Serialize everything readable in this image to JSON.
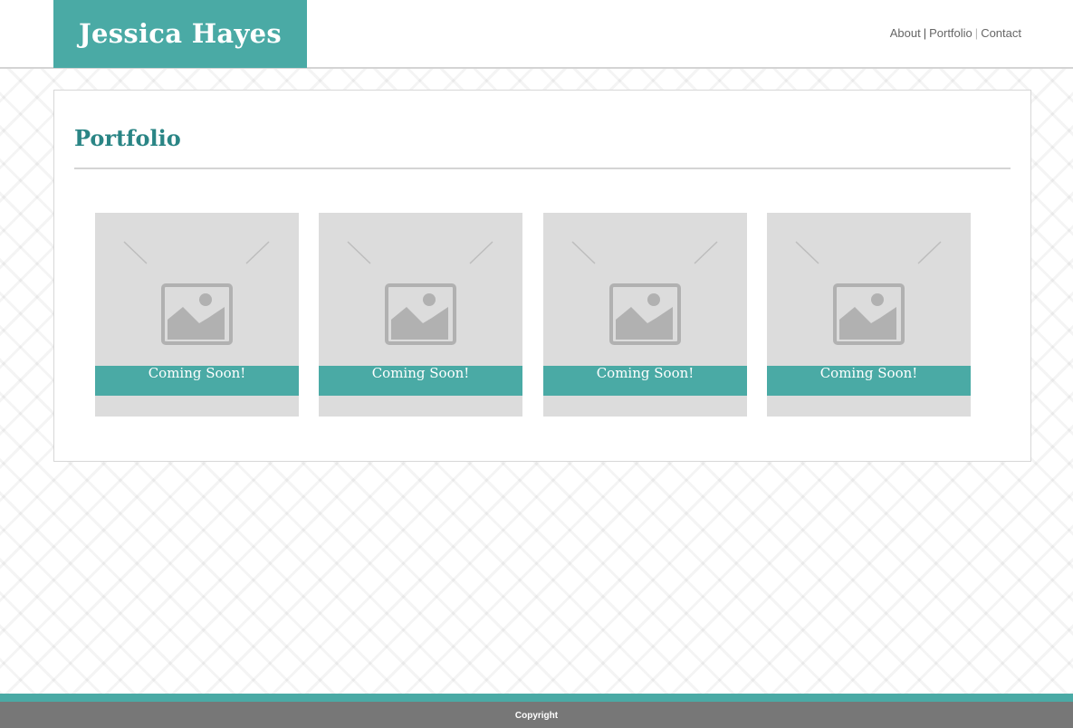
{
  "header": {
    "logo": "Jessica Hayes",
    "nav": [
      {
        "label": "About"
      },
      {
        "label": "Portfolio"
      },
      {
        "label": "Contact"
      }
    ],
    "separator": "|"
  },
  "main": {
    "title": "Portfolio",
    "cards": [
      {
        "caption": "Coming Soon!",
        "icon": "image-placeholder-icon"
      },
      {
        "caption": "Coming Soon!",
        "icon": "image-placeholder-icon"
      },
      {
        "caption": "Coming Soon!",
        "icon": "image-placeholder-icon"
      },
      {
        "caption": "Coming Soon!",
        "icon": "image-placeholder-icon"
      }
    ]
  },
  "footer": {
    "text": "Copyright"
  },
  "colors": {
    "accent": "#4aaaa5",
    "title": "#2a8585",
    "footer": "#777777",
    "card": "#dcdcdc"
  }
}
